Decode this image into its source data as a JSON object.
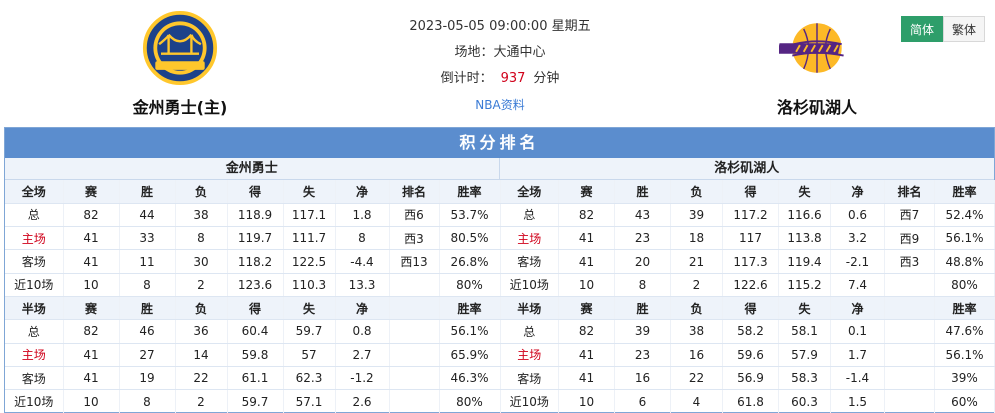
{
  "header": {
    "home_team": "金州勇士(主)",
    "away_team": "洛杉矶湖人",
    "datetime": "2023-05-05 09:00:00 星期五",
    "venue": "场地：大通中心",
    "countdown_label": "倒计时：",
    "countdown_value": "937",
    "countdown_unit": "分钟",
    "nba_link": "NBA资料",
    "home_logo_icon": "warriors-logo",
    "away_logo_icon": "lakers-logo"
  },
  "lang": {
    "simplified": "简体",
    "traditional": "繁体"
  },
  "standings": {
    "title": "积分排名",
    "home_name": "金州勇士",
    "away_name": "洛杉矶湖人",
    "columns_full": [
      "全场",
      "赛",
      "胜",
      "负",
      "得",
      "失",
      "净",
      "排名",
      "胜率"
    ],
    "columns_half": [
      "半场",
      "赛",
      "胜",
      "负",
      "得",
      "失",
      "净",
      "",
      "胜率"
    ],
    "home": {
      "full": [
        [
          "总",
          "82",
          "44",
          "38",
          "118.9",
          "117.1",
          "1.8",
          "西6",
          "53.7%"
        ],
        [
          "主场",
          "41",
          "33",
          "8",
          "119.7",
          "111.7",
          "8",
          "西3",
          "80.5%"
        ],
        [
          "客场",
          "41",
          "11",
          "30",
          "118.2",
          "122.5",
          "-4.4",
          "西13",
          "26.8%"
        ],
        [
          "近10场",
          "10",
          "8",
          "2",
          "123.6",
          "110.3",
          "13.3",
          "",
          "80%"
        ]
      ],
      "half": [
        [
          "总",
          "82",
          "46",
          "36",
          "60.4",
          "59.7",
          "0.8",
          "",
          "56.1%"
        ],
        [
          "主场",
          "41",
          "27",
          "14",
          "59.8",
          "57",
          "2.7",
          "",
          "65.9%"
        ],
        [
          "客场",
          "41",
          "19",
          "22",
          "61.1",
          "62.3",
          "-1.2",
          "",
          "46.3%"
        ],
        [
          "近10场",
          "10",
          "8",
          "2",
          "59.7",
          "57.1",
          "2.6",
          "",
          "80%"
        ]
      ]
    },
    "away": {
      "full": [
        [
          "总",
          "82",
          "43",
          "39",
          "117.2",
          "116.6",
          "0.6",
          "西7",
          "52.4%"
        ],
        [
          "主场",
          "41",
          "23",
          "18",
          "117",
          "113.8",
          "3.2",
          "西9",
          "56.1%"
        ],
        [
          "客场",
          "41",
          "20",
          "21",
          "117.3",
          "119.4",
          "-2.1",
          "西3",
          "48.8%"
        ],
        [
          "近10场",
          "10",
          "8",
          "2",
          "122.6",
          "115.2",
          "7.4",
          "",
          "80%"
        ]
      ],
      "half": [
        [
          "总",
          "82",
          "39",
          "38",
          "58.2",
          "58.1",
          "0.1",
          "",
          "47.6%"
        ],
        [
          "主场",
          "41",
          "23",
          "16",
          "59.6",
          "57.9",
          "1.7",
          "",
          "56.1%"
        ],
        [
          "客场",
          "41",
          "16",
          "22",
          "56.9",
          "58.3",
          "-1.4",
          "",
          "39%"
        ],
        [
          "近10场",
          "10",
          "6",
          "4",
          "61.8",
          "60.3",
          "1.5",
          "",
          "60%"
        ]
      ]
    }
  },
  "colors": {
    "title_bar": "#5b8dce",
    "highlight_red": "#d0021b",
    "active_lang": "#2e9e6a"
  }
}
